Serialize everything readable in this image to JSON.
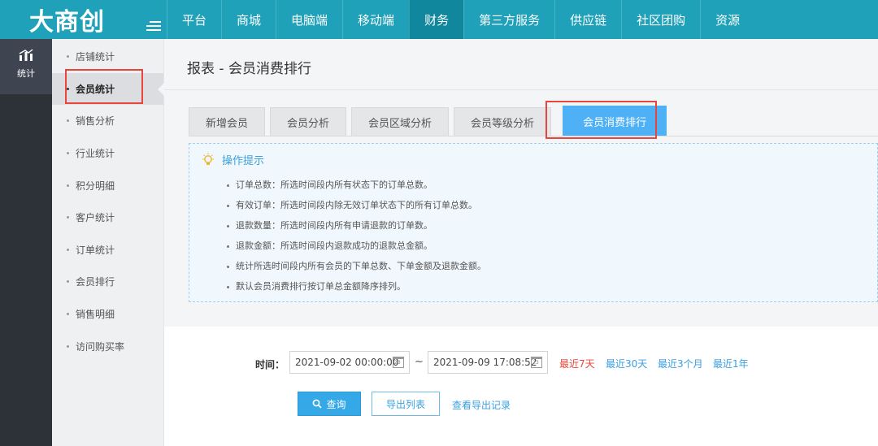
{
  "brand": {
    "logo_text": "大商创"
  },
  "top_nav": {
    "items": [
      {
        "label": "平台"
      },
      {
        "label": "商城"
      },
      {
        "label": "电脑端"
      },
      {
        "label": "移动端"
      },
      {
        "label": "财务"
      },
      {
        "label": "第三方服务"
      },
      {
        "label": "供应链"
      },
      {
        "label": "社区团购"
      },
      {
        "label": "资源"
      }
    ],
    "active_index": 4
  },
  "icon_sidebar": {
    "items": [
      {
        "label": "统计",
        "icon": "bar-chart-icon"
      }
    ]
  },
  "sub_sidebar": {
    "items": [
      {
        "label": "店铺统计"
      },
      {
        "label": "会员统计"
      },
      {
        "label": "销售分析"
      },
      {
        "label": "行业统计"
      },
      {
        "label": "积分明细"
      },
      {
        "label": "客户统计"
      },
      {
        "label": "订单统计"
      },
      {
        "label": "会员排行"
      },
      {
        "label": "销售明细"
      },
      {
        "label": "访问购买率"
      }
    ],
    "active_index": 1
  },
  "page": {
    "title": "报表 - 会员消费排行"
  },
  "tabs": {
    "items": [
      {
        "label": "新增会员"
      },
      {
        "label": "会员分析"
      },
      {
        "label": "会员区域分析"
      },
      {
        "label": "会员等级分析"
      },
      {
        "label": "会员消费排行"
      }
    ],
    "active_index": 4
  },
  "tips": {
    "title": "操作提示",
    "icon": "lightbulb-icon",
    "items": [
      "订单总数：所选时间段内所有状态下的订单总数。",
      "有效订单：所选时间段内除无效订单状态下的所有订单总数。",
      "退款数量：所选时间段内所有申请退款的订单数。",
      "退款金额：所选时间段内退款成功的退款总金额。",
      "统计所选时间段内所有会员的下单总数、下单金额及退款金额。",
      "默认会员消费排行按订单总金额降序排列。"
    ]
  },
  "filter": {
    "time_label": "时间：",
    "start_date": "2021-09-02 00:00:00",
    "separator": "~",
    "end_date": "2021-09-09 17:08:52",
    "quick_ranges": [
      {
        "label": "最近7天",
        "color": "#e8453c"
      },
      {
        "label": "最近30天",
        "color": "#3a9fe0"
      },
      {
        "label": "最近3个月",
        "color": "#3a9fe0"
      },
      {
        "label": "最近1年",
        "color": "#3a9fe0"
      }
    ],
    "query_button": "查询",
    "export_button": "导出列表",
    "records_link": "查看导出记录"
  },
  "colors": {
    "header_bg": "#1ea1b9",
    "active_nav_bg": "#10879c",
    "active_tab_bg": "#4fb1f5",
    "highlight_border": "#e8453c"
  }
}
